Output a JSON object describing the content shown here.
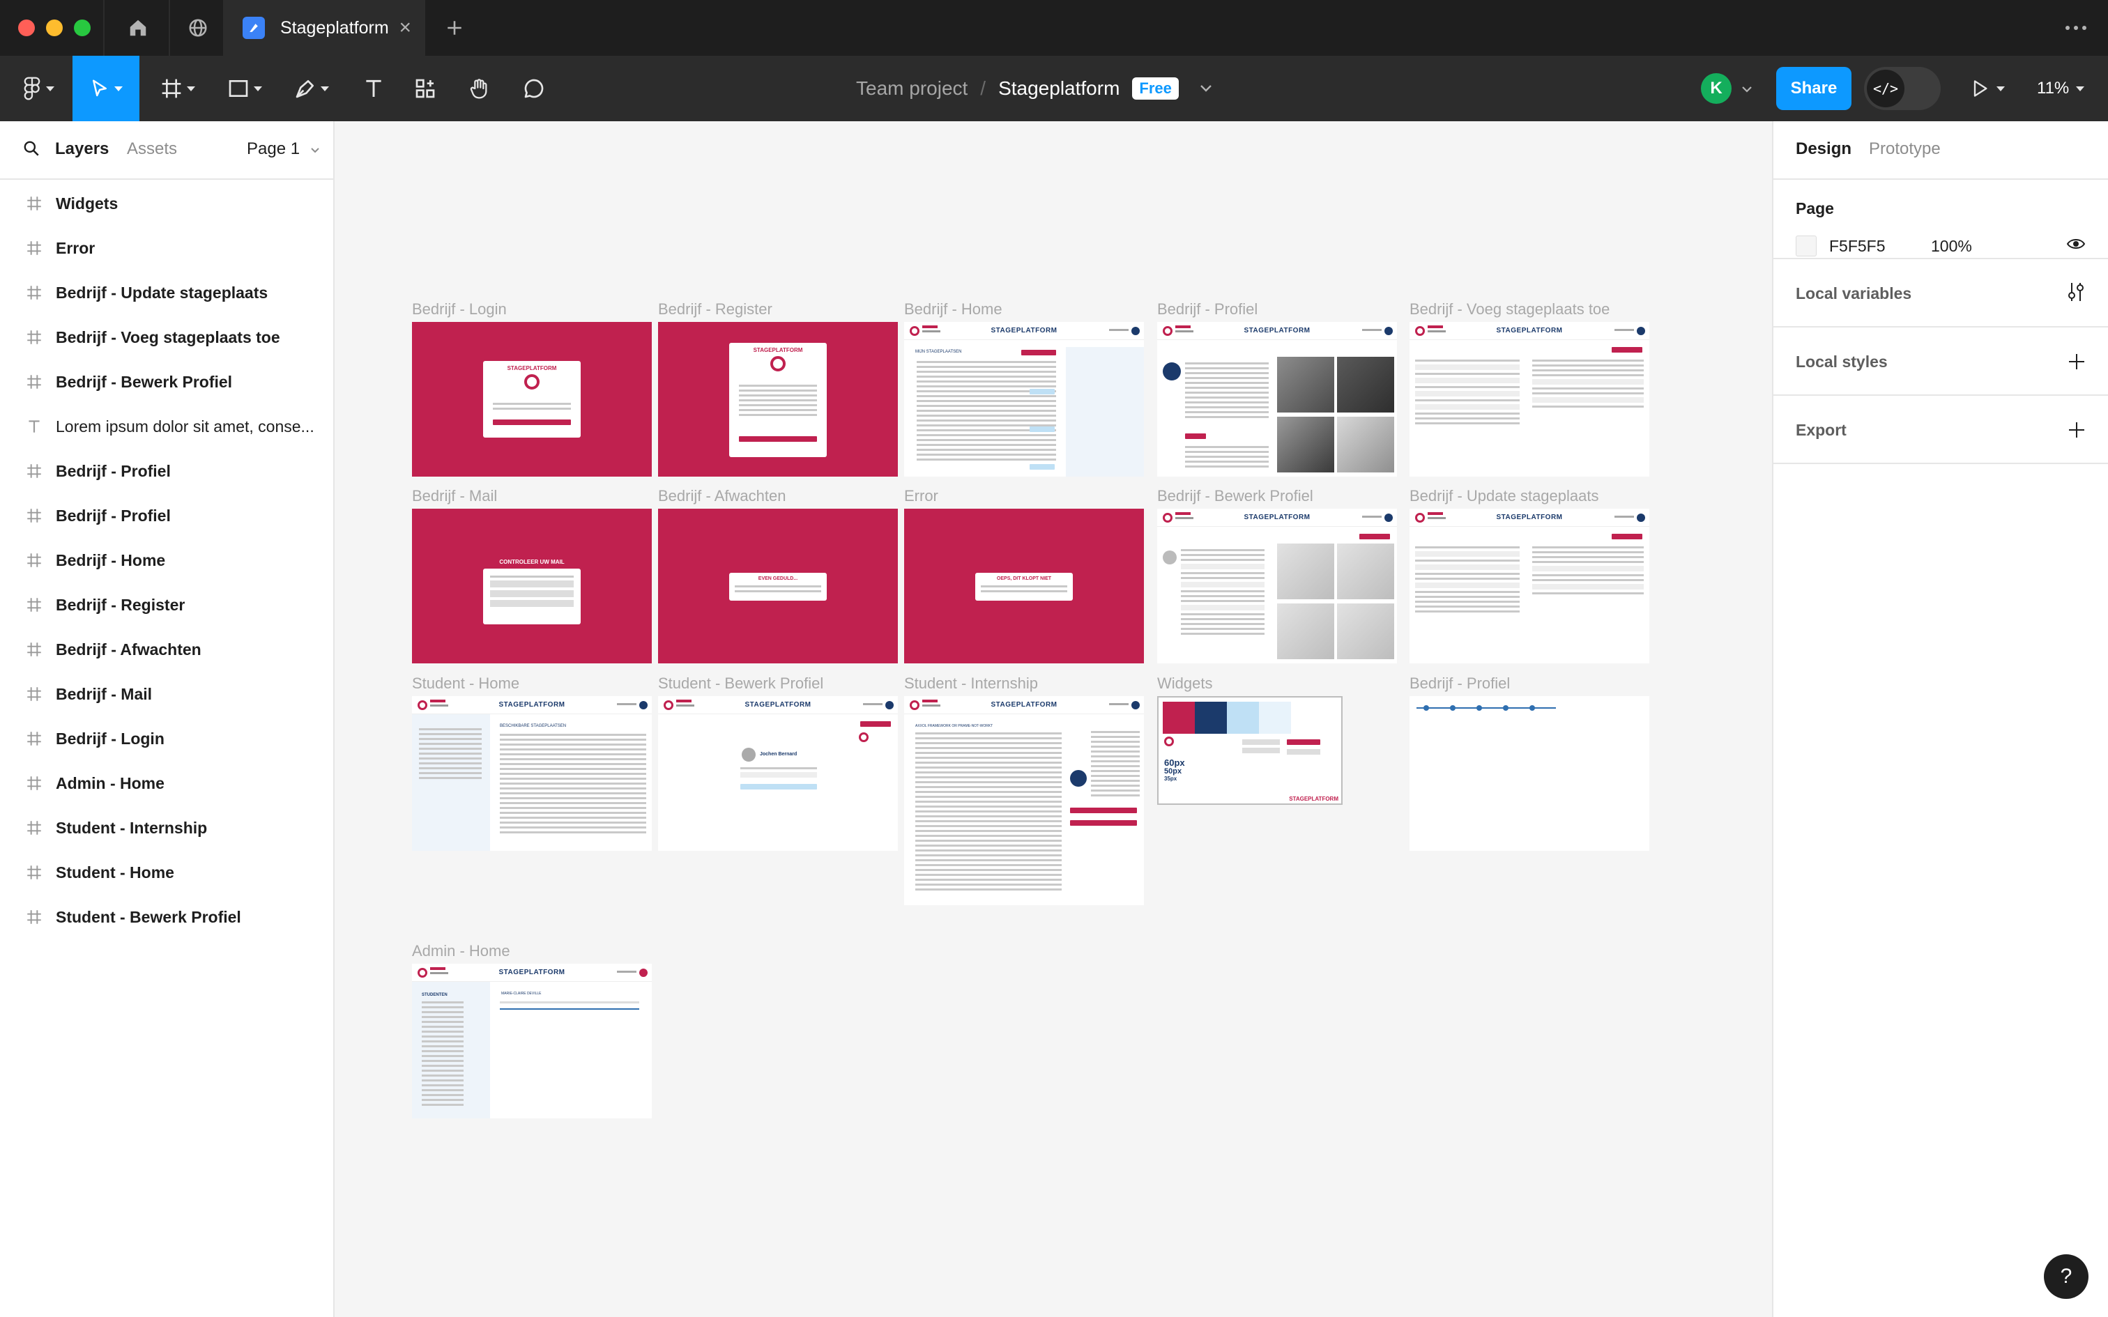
{
  "window": {
    "tab_title": "Stageplatform"
  },
  "toolbar": {
    "team": "Team project",
    "separator": "/",
    "file": "Stageplatform",
    "plan_badge": "Free",
    "avatar_initial": "K",
    "share_label": "Share",
    "zoom": "11%"
  },
  "left_panel": {
    "tab_layers": "Layers",
    "tab_assets": "Assets",
    "page_selector": "Page 1",
    "layers": [
      {
        "name": "Widgets",
        "icon": "frame-icon"
      },
      {
        "name": "Error",
        "icon": "frame-icon"
      },
      {
        "name": "Bedrijf - Update stageplaats",
        "icon": "frame-icon"
      },
      {
        "name": "Bedrijf - Voeg stageplaats toe",
        "icon": "frame-icon"
      },
      {
        "name": "Bedrijf - Bewerk Profiel",
        "icon": "frame-icon"
      },
      {
        "name": "Lorem ipsum dolor sit amet, conse...",
        "icon": "text-icon"
      },
      {
        "name": "Bedrijf - Profiel",
        "icon": "frame-icon"
      },
      {
        "name": "Bedrijf - Profiel",
        "icon": "frame-icon"
      },
      {
        "name": "Bedrijf - Home",
        "icon": "frame-icon"
      },
      {
        "name": "Bedrijf - Register",
        "icon": "frame-icon"
      },
      {
        "name": "Bedrijf - Afwachten",
        "icon": "frame-icon"
      },
      {
        "name": "Bedrijf - Mail",
        "icon": "frame-icon"
      },
      {
        "name": "Bedrijf - Login",
        "icon": "frame-icon"
      },
      {
        "name": "Admin - Home",
        "icon": "frame-icon"
      },
      {
        "name": "Student - Internship",
        "icon": "frame-icon"
      },
      {
        "name": "Student - Home",
        "icon": "frame-icon"
      },
      {
        "name": "Student - Bewerk Profiel",
        "icon": "frame-icon"
      }
    ]
  },
  "right_panel": {
    "tab_design": "Design",
    "tab_prototype": "Prototype",
    "page_section": "Page",
    "page_color": "F5F5F5",
    "page_opacity": "100%",
    "local_variables": "Local variables",
    "local_styles": "Local styles",
    "export": "Export"
  },
  "canvas": {
    "frames": {
      "login": {
        "label": "Bedrijf - Login",
        "title": "STAGEPLATFORM"
      },
      "register": {
        "label": "Bedrijf - Register",
        "title": "STAGEPLATFORM"
      },
      "bhome": {
        "label": "Bedrijf - Home",
        "brand": "STAGEPLATFORM",
        "heading": "MIJN STAGEPLAATSEN"
      },
      "bprofiel1": {
        "label": "Bedrijf - Profiel",
        "brand": "STAGEPLATFORM"
      },
      "voeg": {
        "label": "Bedrijf - Voeg stageplaats toe",
        "brand": "STAGEPLATFORM"
      },
      "mail": {
        "label": "Bedrijf - Mail",
        "title": "CONTROLEER UW MAIL"
      },
      "afwachten": {
        "label": "Bedrijf - Afwachten",
        "title": "EVEN GEDULD..."
      },
      "error": {
        "label": "Error",
        "title": "OEPS, DIT KLOPT NIET"
      },
      "bewerk": {
        "label": "Bedrijf - Bewerk Profiel",
        "brand": "STAGEPLATFORM"
      },
      "update": {
        "label": "Bedrijf - Update stageplaats",
        "brand": "STAGEPLATFORM"
      },
      "shome": {
        "label": "Student - Home",
        "brand": "STAGEPLATFORM",
        "heading": "BESCHIKBARE STAGEPLAATSEN"
      },
      "sbewerk": {
        "label": "Student - Bewerk Profiel",
        "brand": "STAGEPLATFORM",
        "person": "Jochen Bernard"
      },
      "sintern": {
        "label": "Student - Internship",
        "brand": "STAGEPLATFORM",
        "heading": "AXXOL FRAMEWORK OR PRAME-NOT-WORKT"
      },
      "widgets": {
        "label": "Widgets",
        "sizes": [
          "60px",
          "50px",
          "35px"
        ],
        "brand": "STAGEPLATFORM"
      },
      "bprofiel2": {
        "label": "Bedrijf - Profiel"
      },
      "ahome": {
        "label": "Admin - Home",
        "brand": "STAGEPLATFORM",
        "side_title": "STUDENTEN",
        "person": "MARIE-CLAIRE DEVILLE"
      }
    }
  },
  "colors": {
    "brand_red": "#C0214F",
    "brand_navy": "#1B3A6B",
    "figma_blue": "#0D99FF",
    "avatar_green": "#14AE5C"
  }
}
